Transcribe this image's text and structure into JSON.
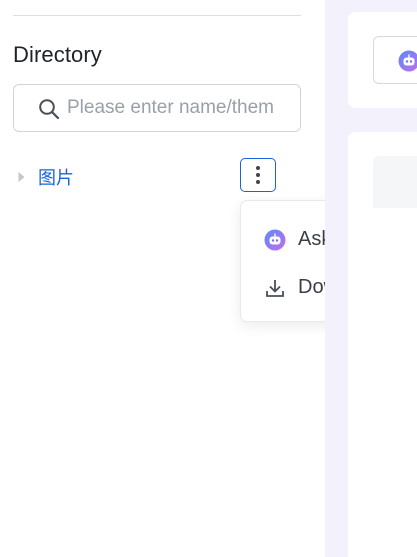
{
  "sidebar": {
    "title": "Directory",
    "search": {
      "placeholder": "Please enter name/them",
      "value": ""
    },
    "tree": [
      {
        "label": "图片"
      }
    ]
  },
  "context_menu": {
    "items": [
      {
        "label": "Ask AI",
        "icon": "ai-robot-icon"
      },
      {
        "label": "Download",
        "icon": "download-icon"
      }
    ]
  },
  "colors": {
    "accent": "#1a62d9",
    "ai_gradient_start": "#8a6cf6",
    "ai_gradient_end": "#c36cf0",
    "panel_background": "#f3f1fb"
  }
}
